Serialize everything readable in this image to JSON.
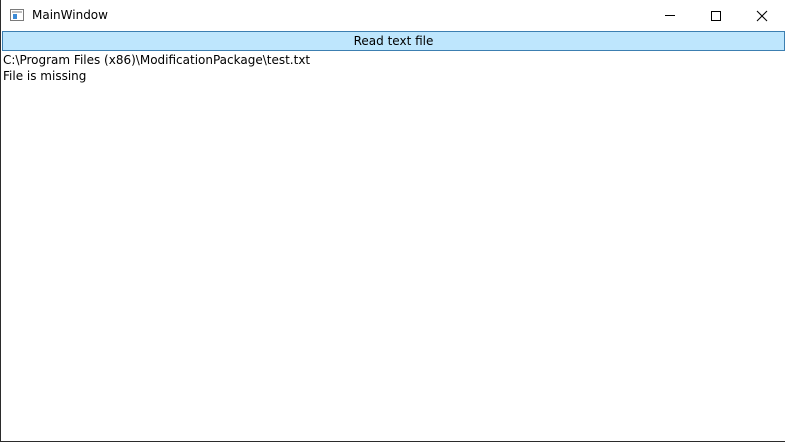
{
  "window": {
    "title": "MainWindow",
    "icon": "app-window-icon",
    "controls": {
      "minimize_icon": "minimize-icon",
      "maximize_icon": "maximize-icon",
      "close_icon": "close-icon"
    }
  },
  "toolbar": {
    "read_label": "Read text file"
  },
  "content": {
    "file_path": "C:\\Program Files (x86)\\ModificationPackage\\test.txt",
    "status": "File is missing"
  },
  "colors": {
    "button_bg": "#bee6fd",
    "button_border": "#3c7fb1",
    "text": "#000000",
    "background": "#ffffff"
  }
}
